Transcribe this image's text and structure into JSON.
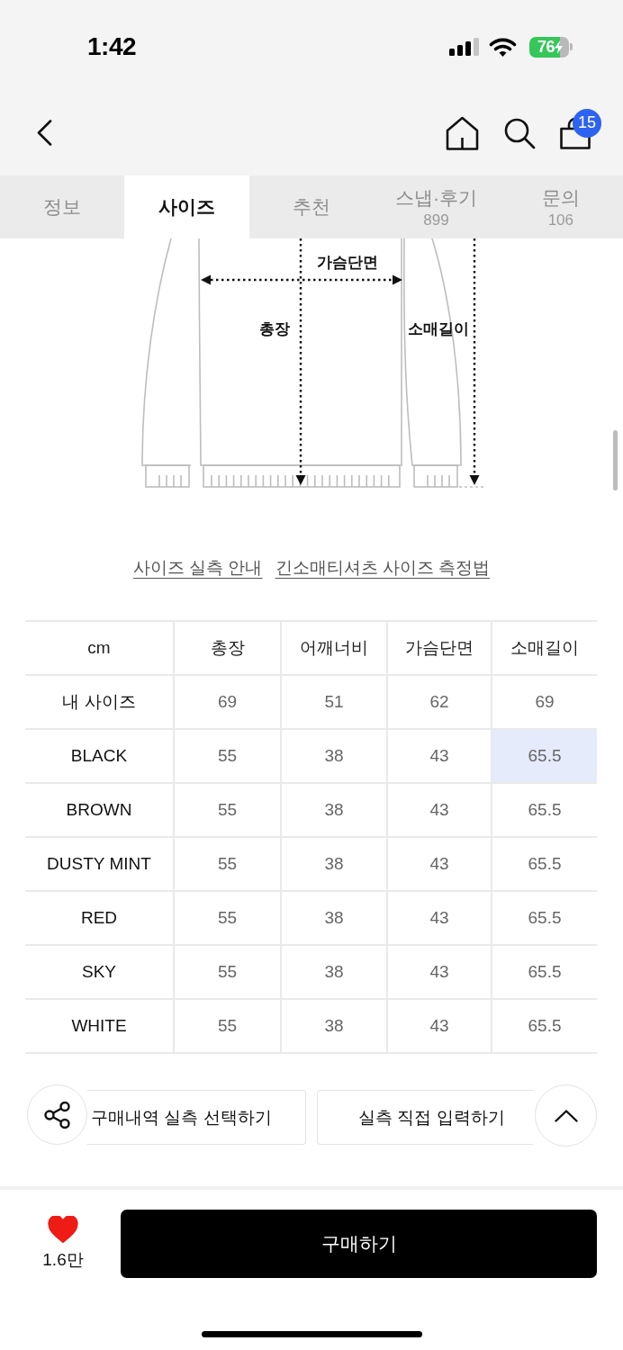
{
  "status_bar": {
    "time": "1:42",
    "battery": "76"
  },
  "header": {
    "cart_count": "15"
  },
  "tabs": [
    {
      "label": "정보",
      "selected": false
    },
    {
      "label": "사이즈",
      "selected": true
    },
    {
      "label": "추천",
      "selected": false
    },
    {
      "label": "스냅·후기",
      "count": "899",
      "selected": false
    },
    {
      "label": "문의",
      "count": "106",
      "selected": false
    }
  ],
  "size_diagram": {
    "chest_label": "가슴단면",
    "length_label": "총장",
    "sleeve_label": "소매길이"
  },
  "guide_links": [
    "사이즈 실측 안내",
    "긴소매티셔츠 사이즈 측정법"
  ],
  "size_table": {
    "corner": "cm",
    "columns": [
      "총장",
      "어깨너비",
      "가슴단면",
      "소매길이"
    ],
    "rows": [
      {
        "label": "내 사이즈",
        "cells": [
          {
            "text": "69",
            "highlighted": false
          },
          {
            "text": "51",
            "highlighted": false
          },
          {
            "text": "62",
            "highlighted": false
          },
          {
            "text": "69",
            "highlighted": false
          }
        ]
      },
      {
        "label": "BLACK",
        "cells": [
          {
            "text": "55",
            "highlighted": false
          },
          {
            "text": "38",
            "highlighted": false
          },
          {
            "text": "43",
            "highlighted": false
          },
          {
            "text": "65.5",
            "highlighted": true
          }
        ]
      },
      {
        "label": "BROWN",
        "cells": [
          {
            "text": "55",
            "highlighted": false
          },
          {
            "text": "38",
            "highlighted": false
          },
          {
            "text": "43",
            "highlighted": false
          },
          {
            "text": "65.5",
            "highlighted": false
          }
        ]
      },
      {
        "label": "DUSTY MINT",
        "cells": [
          {
            "text": "55",
            "highlighted": false
          },
          {
            "text": "38",
            "highlighted": false
          },
          {
            "text": "43",
            "highlighted": false
          },
          {
            "text": "65.5",
            "highlighted": false
          }
        ]
      },
      {
        "label": "RED",
        "cells": [
          {
            "text": "55",
            "highlighted": false
          },
          {
            "text": "38",
            "highlighted": false
          },
          {
            "text": "43",
            "highlighted": false
          },
          {
            "text": "65.5",
            "highlighted": false
          }
        ]
      },
      {
        "label": "SKY",
        "cells": [
          {
            "text": "55",
            "highlighted": false
          },
          {
            "text": "38",
            "highlighted": false
          },
          {
            "text": "43",
            "highlighted": false
          },
          {
            "text": "65.5",
            "highlighted": false
          }
        ]
      },
      {
        "label": "WHITE",
        "cells": [
          {
            "text": "55",
            "highlighted": false
          },
          {
            "text": "38",
            "highlighted": false
          },
          {
            "text": "43",
            "highlighted": false
          },
          {
            "text": "65.5",
            "highlighted": false
          }
        ]
      }
    ]
  },
  "action_buttons": [
    "구매내역 실측 선택하기",
    "실측 직접 입력하기"
  ],
  "bottom_bar": {
    "liked": true,
    "like_count": "1.6만",
    "buy_button": "구매하기"
  }
}
